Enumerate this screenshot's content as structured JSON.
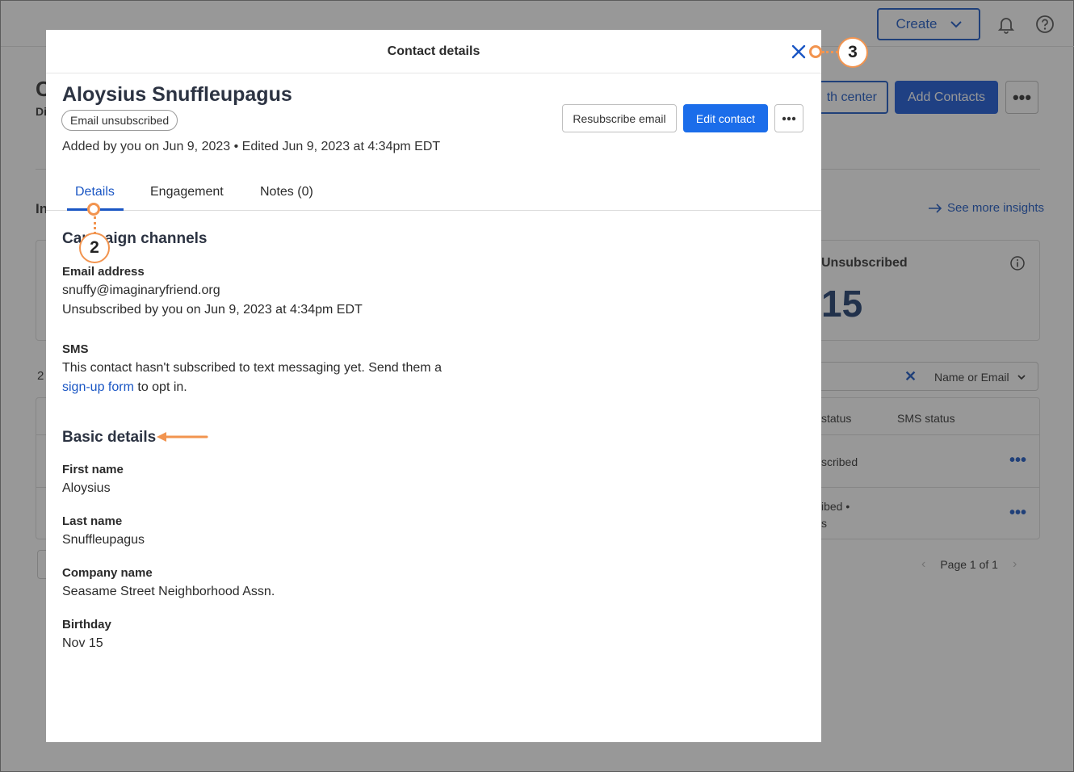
{
  "background": {
    "create_label": "Create",
    "page_title_fragment": "C",
    "page_sub_fragment": "Di",
    "growth_label": "th center",
    "add_contacts_label": "Add Contacts",
    "insights_heading_fragment": "In",
    "see_more_label": "See more insights",
    "unsubscribed_label": "Unsubscribed",
    "unsubscribed_value": "15",
    "count_fragment": "2",
    "search_filter_label": "Name or Email",
    "columns": [
      "status",
      "SMS status"
    ],
    "rows": [
      {
        "line1": "scribed",
        "line2": ""
      },
      {
        "line1": "ibed •",
        "line2": "s"
      }
    ],
    "pager_label": "Page 1 of 1"
  },
  "modal": {
    "title": "Contact details",
    "contact_name": "Aloysius Snuffleupagus",
    "status_badge": "Email unsubscribed",
    "added_line": "Added by you on Jun 9, 2023 • Edited Jun 9, 2023 at 4:34pm EDT",
    "resubscribe_label": "Resubscribe email",
    "edit_label": "Edit contact",
    "tabs": [
      {
        "label": "Details",
        "active": true
      },
      {
        "label": "Engagement",
        "active": false
      },
      {
        "label": "Notes (0)",
        "active": false
      }
    ],
    "campaign_channels": {
      "heading": "Campaign channels",
      "email_label": "Email address",
      "email_value": "snuffy@imaginaryfriend.org",
      "email_status": "Unsubscribed by you on Jun 9, 2023 at 4:34pm EDT",
      "sms_label": "SMS",
      "sms_text_1": "This contact hasn't subscribed to text messaging yet. Send them a",
      "sms_link": "sign-up form",
      "sms_text_2": " to opt in."
    },
    "basic_details": {
      "heading": "Basic details",
      "fields": [
        {
          "label": "First name",
          "value": "Aloysius"
        },
        {
          "label": "Last name",
          "value": "Snuffleupagus"
        },
        {
          "label": "Company name",
          "value": "Seasame Street Neighborhood Assn."
        },
        {
          "label": "Birthday",
          "value": "Nov 15"
        }
      ]
    }
  },
  "annotations": {
    "callout_2": "2",
    "callout_3": "3"
  },
  "colors": {
    "accent": "#1a56c4",
    "primary_button": "#1b6dea",
    "annotation": "#f2944f",
    "overlay": "rgba(40,40,40,0.48)"
  }
}
